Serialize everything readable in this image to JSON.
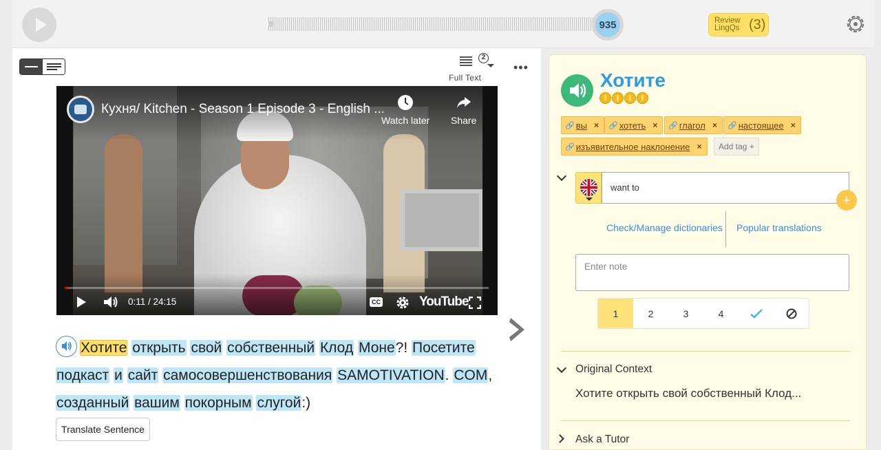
{
  "topbar": {
    "known_count": "935",
    "review": {
      "label": "Review LingQs",
      "count": "(3)"
    }
  },
  "reader": {
    "fulltext": {
      "label": "Full Text",
      "badge": "2"
    },
    "video": {
      "title": "Кухня/ Kitchen - Season 1 Episode 3 - English ...",
      "watch_later": "Watch later",
      "share": "Share",
      "time": "0:11 / 24:15",
      "brand": "YouTube",
      "progress": 0.008
    },
    "sentence": [
      {
        "w": "Хотите",
        "sel": true
      },
      {
        "p": " "
      },
      {
        "w": "открыть"
      },
      {
        "p": " "
      },
      {
        "w": "свой"
      },
      {
        "p": " "
      },
      {
        "w": "собственный"
      },
      {
        "p": " "
      },
      {
        "w": "Клод"
      },
      {
        "p": " "
      },
      {
        "w": "Моне"
      },
      {
        "p": "?! "
      },
      {
        "w": "Посетите"
      },
      {
        "p": " "
      },
      {
        "w": "подкаст"
      },
      {
        "p": " "
      },
      {
        "w": "и"
      },
      {
        "p": " "
      },
      {
        "w": "сайт"
      },
      {
        "p": " "
      },
      {
        "w": "самосовершенствования"
      },
      {
        "p": " "
      },
      {
        "w": "SAMOTIVATION"
      },
      {
        "p": ". "
      },
      {
        "w": "COM"
      },
      {
        "p": ", "
      },
      {
        "w": "созданный"
      },
      {
        "p": " "
      },
      {
        "w": "вашим"
      },
      {
        "p": " "
      },
      {
        "w": "покорным"
      },
      {
        "p": " "
      },
      {
        "w": "слугой"
      },
      {
        "p": ":)"
      }
    ],
    "translate_button": "Translate Sentence"
  },
  "panel": {
    "word": "Хотите",
    "coins": 4,
    "tags": [
      "вы",
      "хотеть",
      "глагол",
      "настоящее",
      "изъявительное наклонение"
    ],
    "tag_remove": "×",
    "add_tag": "Add tag +",
    "translation": {
      "value": "want to",
      "language_icon": "uk-flag-icon"
    },
    "links": {
      "dictionaries": "Check/Manage dictionaries",
      "popular": "Popular translations"
    },
    "note_placeholder": "Enter note",
    "status_levels": [
      "1",
      "2",
      "3",
      "4"
    ],
    "status_selected": "1",
    "sections": {
      "context_title": "Original Context",
      "context_text": "Хотите открыть свой собственный Клод...",
      "tutor_title": "Ask a Tutor"
    }
  },
  "colors": {
    "accent_blue": "#2d9be0",
    "highlight_yellow": "#ffe066",
    "word_blue": "#bfe6f7",
    "audio_green": "#3cb878"
  }
}
